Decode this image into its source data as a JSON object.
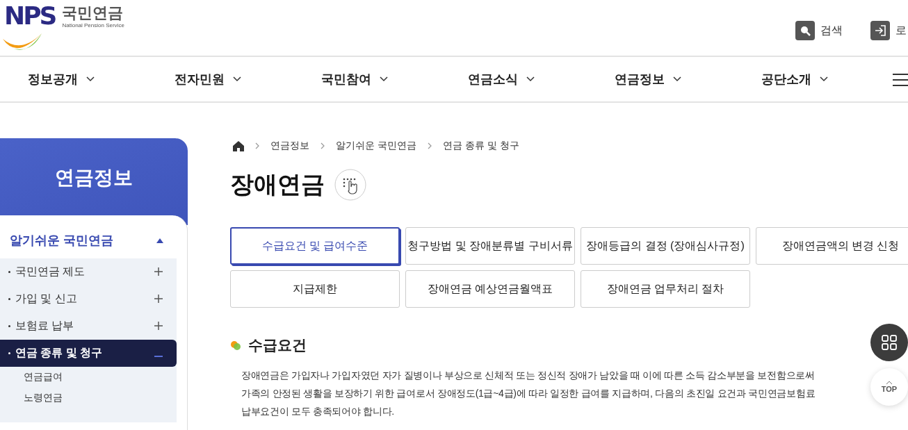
{
  "header": {
    "logo_mark": "NPS",
    "logo_name": "국민연금",
    "logo_sub": "National Pension Service",
    "utilities": [
      {
        "kind": "search",
        "label": "검색"
      },
      {
        "kind": "login",
        "label": "로"
      }
    ]
  },
  "nav": {
    "items": [
      {
        "label": "정보공개"
      },
      {
        "label": "전자민원"
      },
      {
        "label": "국민참여"
      },
      {
        "label": "연금소식"
      },
      {
        "label": "연금정보"
      },
      {
        "label": "공단소개"
      }
    ]
  },
  "sidebar": {
    "title": "연금정보",
    "section": {
      "label": "알기쉬운 국민연금",
      "expanded": true
    },
    "items": [
      {
        "label": "국민연금 제도",
        "selected": false,
        "expanded": false
      },
      {
        "label": "가입 및 신고",
        "selected": false,
        "expanded": false
      },
      {
        "label": "보험료 납부",
        "selected": false,
        "expanded": false
      },
      {
        "label": "연금 종류 및 청구",
        "selected": true,
        "expanded": true,
        "children": [
          {
            "label": "연금급여"
          },
          {
            "label": "노령연금"
          }
        ]
      }
    ]
  },
  "breadcrumb": [
    "연금정보",
    "알기쉬운 국민연금",
    "연금 종류 및 청구"
  ],
  "page_title": "장애연금",
  "tabs": [
    {
      "label": "수급요건 및 급여수준",
      "selected": true
    },
    {
      "label": "청구방법 및 장애분류별 구비서류",
      "selected": false
    },
    {
      "label": "장애등급의 결정 (장애심사규정)",
      "selected": false
    },
    {
      "label": "장애연금액의 변경 신청",
      "selected": false
    },
    {
      "label": "지급제한",
      "selected": false
    },
    {
      "label": "장애연금 예상연금월액표",
      "selected": false
    },
    {
      "label": "장애연금 업무처리 절차",
      "selected": false
    }
  ],
  "section_heading": "수급요건",
  "paragraph_lines": [
    "장애연금은 가입자나 가입자였던 자가 질병이나 부상으로 신체적 또는 정신적 장애가 남았을 때 이에 따른 소득 감소부분을 보전함으로써",
    "가족의 안정된 생활을 보장하기 위한 급여로서 장애정도(1급~4급)에 따라 일정한 급여를 지급하며, 다음의 초진일 요건과 국민연금보험료",
    "납부요건이 모두 충족되어야 합니다."
  ],
  "floating": {
    "top_label": "TOP"
  }
}
